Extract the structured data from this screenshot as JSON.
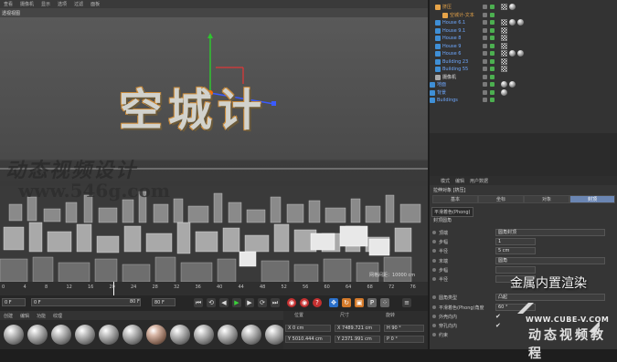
{
  "menubar": [
    "查看",
    "摄像机",
    "显示",
    "选项",
    "过滤",
    "面板"
  ],
  "viewport": {
    "label": "透视视图",
    "logo_text": "空城计",
    "grid_readout": "网格间距：10000 cm"
  },
  "watermark": {
    "cn": "动态视频设计",
    "url": "www.546g.com"
  },
  "timeline": {
    "ticks": [
      "0",
      "4",
      "8",
      "12",
      "16",
      "20",
      "24",
      "28",
      "32",
      "36",
      "40",
      "44",
      "48",
      "52",
      "56",
      "60",
      "64",
      "68",
      "72",
      "76"
    ]
  },
  "transport": {
    "frame_start": "0 F",
    "frame_current": "0 F",
    "frame_end": "80 F",
    "frame_end2": "80 F"
  },
  "materials": {
    "tabs": [
      "创建",
      "编辑",
      "功能",
      "纹理"
    ],
    "count": 12
  },
  "coordinates": {
    "headers": [
      "位置",
      "尺寸",
      "旋转"
    ],
    "x_pos": "X  0 cm",
    "y_pos": "Y  5010.444 cm",
    "x_size": "X  7489.721 cm",
    "y_size": "Y  2371.991 cm",
    "h_rot": "H  90 °",
    "p_rot": "P  0 °"
  },
  "objects": [
    {
      "name": "挤压",
      "class": "sel",
      "indent": 14,
      "tags": [
        "check",
        "sphere"
      ]
    },
    {
      "name": "空城计-文本",
      "class": "sel",
      "indent": 22,
      "tags": []
    },
    {
      "name": "House 6.1",
      "class": "",
      "indent": 14,
      "tags": [
        "check",
        "sphere",
        "sphere"
      ]
    },
    {
      "name": "House 9.1",
      "class": "",
      "indent": 14,
      "tags": [
        "check"
      ]
    },
    {
      "name": "House 8",
      "class": "",
      "indent": 14,
      "tags": [
        "check"
      ]
    },
    {
      "name": "House 9",
      "class": "",
      "indent": 14,
      "tags": [
        "check"
      ]
    },
    {
      "name": "House 6",
      "class": "",
      "indent": 14,
      "tags": [
        "check",
        "sphere",
        "sphere"
      ]
    },
    {
      "name": "Building 23",
      "class": "",
      "indent": 14,
      "tags": [
        "check"
      ]
    },
    {
      "name": "Building 55",
      "class": "",
      "indent": 14,
      "tags": [
        "check"
      ]
    },
    {
      "name": "摄像机",
      "class": "white",
      "indent": 14,
      "tags": []
    },
    {
      "name": "地面",
      "class": "",
      "indent": 8,
      "tags": [
        "sphere",
        "sphere"
      ]
    },
    {
      "name": "背景",
      "class": "",
      "indent": 8,
      "tags": [
        "sphere"
      ]
    },
    {
      "name": "Buildings",
      "class": "",
      "indent": 8,
      "tags": []
    }
  ],
  "attributes": {
    "menu": [
      "模式",
      "编辑",
      "用户数据"
    ],
    "title": "拉伸对象 [挤压]",
    "tabs": [
      "基本",
      "坐标",
      "对象",
      "封顶"
    ],
    "phong": "平滑着色(Phong)",
    "section": "封顶圆角",
    "rows": [
      {
        "label": "顶端",
        "value": "圆角封顶",
        "type": "wide"
      },
      {
        "label": "步幅",
        "value": "1",
        "type": "val"
      },
      {
        "label": "半径",
        "value": "5 cm",
        "type": "val"
      },
      {
        "label": "末端",
        "value": "圆角",
        "type": "wide"
      },
      {
        "label": "步幅",
        "value": "",
        "type": "val"
      },
      {
        "label": "半径",
        "value": "",
        "type": "val"
      },
      {
        "label": "",
        "value": "",
        "type": "none"
      },
      {
        "label": "圆角类型",
        "value": "凸起",
        "type": "wide"
      },
      {
        "label": "平滑着色(Phong)角度",
        "value": "60 °",
        "type": "val"
      },
      {
        "label": "外壳向内",
        "value": "✔",
        "type": "chk"
      },
      {
        "label": "穿孔向内",
        "value": "✔",
        "type": "chk"
      },
      {
        "label": "约束",
        "value": "",
        "type": "none"
      }
    ]
  },
  "overlay": {
    "caption": "金属内置渲染",
    "brand_url": "WWW.CUBE-V.COM",
    "brand_cn": "动态视频教程"
  },
  "colors": {
    "selected": "#e7a449",
    "object": "#6ea8ff",
    "active_tab": "#6b86b3"
  }
}
